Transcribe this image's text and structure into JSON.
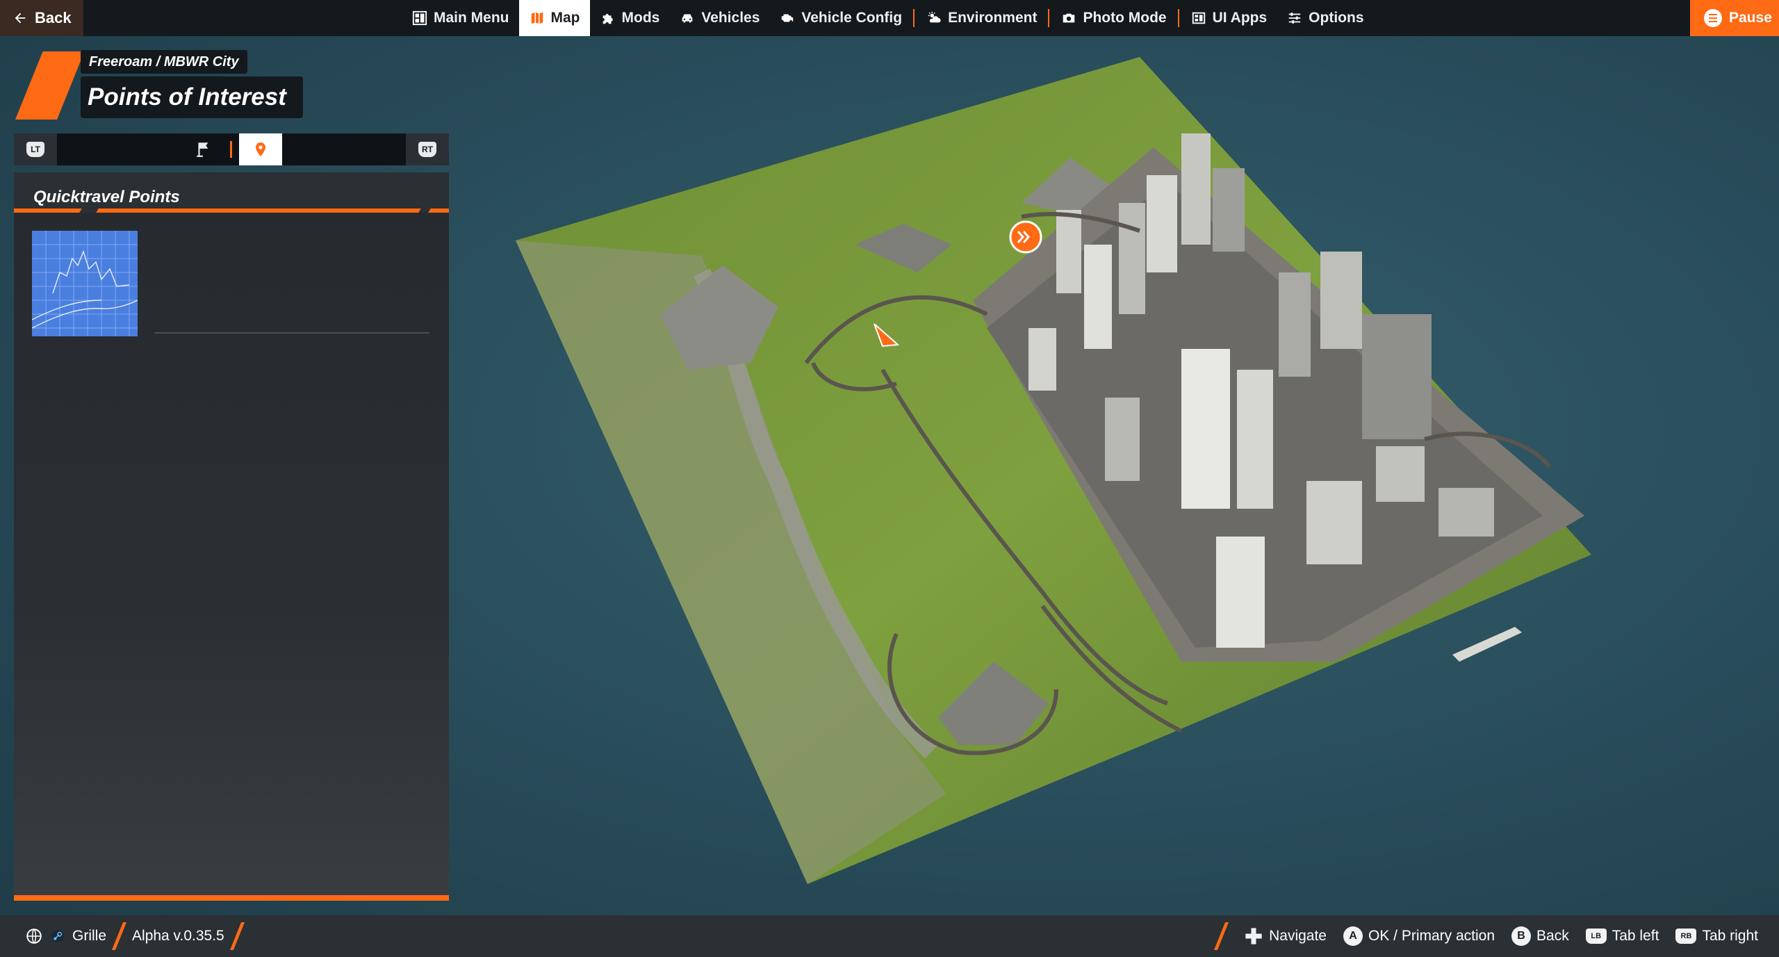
{
  "topbar": {
    "back_label": "Back",
    "pause_label": "Pause",
    "nav": [
      {
        "label": "Main Menu",
        "icon": "main-menu-icon",
        "active": false
      },
      {
        "label": "Map",
        "icon": "map-icon",
        "active": true
      },
      {
        "label": "Mods",
        "icon": "puzzle-icon",
        "active": false
      },
      {
        "label": "Vehicles",
        "icon": "car-icon",
        "active": false
      },
      {
        "label": "Vehicle Config",
        "icon": "engine-icon",
        "active": false
      },
      {
        "label": "Environment",
        "icon": "weather-icon",
        "active": false
      },
      {
        "label": "Photo Mode",
        "icon": "camera-icon",
        "active": false
      },
      {
        "label": "UI Apps",
        "icon": "apps-icon",
        "active": false
      },
      {
        "label": "Options",
        "icon": "sliders-icon",
        "active": false
      }
    ]
  },
  "header": {
    "breadcrumb": "Freeroam / MBWR City",
    "title": "Points of Interest"
  },
  "subtabs": {
    "left_bumper": "LT",
    "right_bumper": "RT",
    "tabs": [
      {
        "icon": "flag-icon",
        "active": false
      },
      {
        "icon": "location-pin-icon",
        "active": true
      }
    ]
  },
  "panel": {
    "section_title": "Quicktravel Points",
    "items": [
      {
        "thumbnail": "city-blueprint-thumbnail"
      }
    ]
  },
  "footer": {
    "user": "Grille",
    "version": "Alpha v.0.35.5",
    "hints": [
      {
        "key": "dpad",
        "label": "Navigate"
      },
      {
        "key": "A",
        "label": "OK / Primary action"
      },
      {
        "key": "B",
        "label": "Back"
      },
      {
        "key": "LB",
        "label": "Tab left"
      },
      {
        "key": "RB",
        "label": "Tab right"
      }
    ]
  },
  "colors": {
    "accent": "#ff6a14",
    "topbar": "#14191e",
    "panel": "#2b2f33",
    "water": "#2f5866",
    "grass": "#7c9a3c"
  }
}
